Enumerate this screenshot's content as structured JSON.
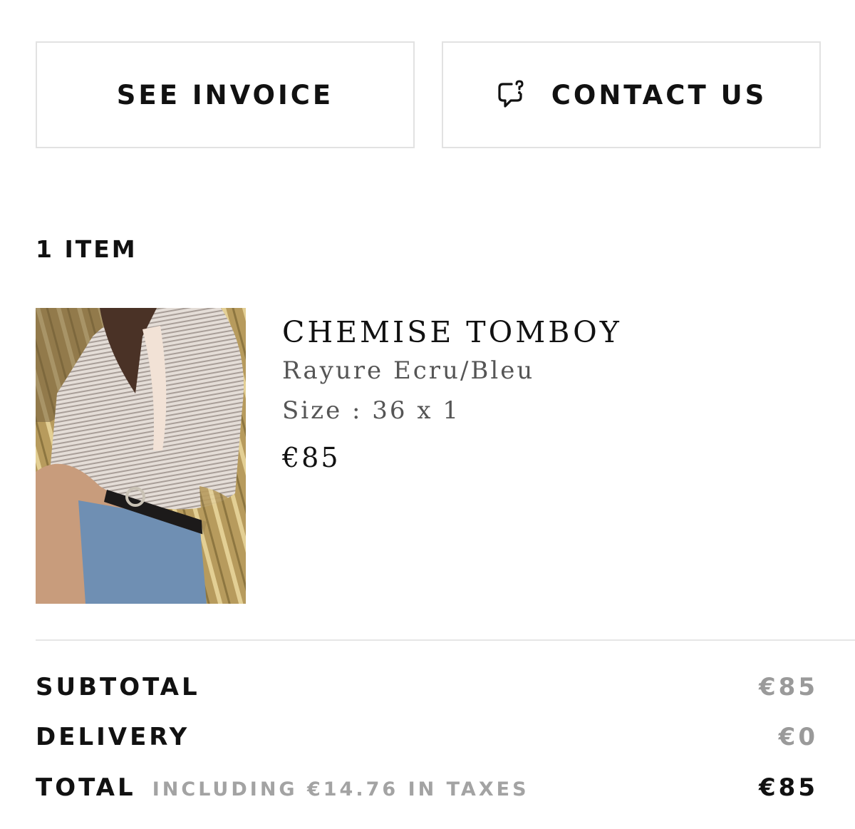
{
  "actions": {
    "see_invoice_label": "SEE INVOICE",
    "contact_us_label": "CONTACT US",
    "contact_icon": "chat-question-icon"
  },
  "order": {
    "items_count_label": "1 ITEM",
    "items": [
      {
        "name": "CHEMISE TOMBOY",
        "color": "Rayure Ecru/Bleu",
        "size_label": "Size",
        "size_separator": ":",
        "size_value": "36 x 1",
        "price": "€85",
        "image": "product-photo-striped-shirt-jeans"
      }
    ]
  },
  "summary": {
    "subtotal_label": "SUBTOTAL",
    "subtotal_value": "€85",
    "delivery_label": "DELIVERY",
    "delivery_value": "€0",
    "total_label": "TOTAL",
    "tax_note": "INCLUDING €14.76 IN TAXES",
    "total_value": "€85"
  },
  "colors": {
    "text_primary": "#111111",
    "text_muted": "#9a9a9a",
    "border": "#e2e2e2"
  }
}
